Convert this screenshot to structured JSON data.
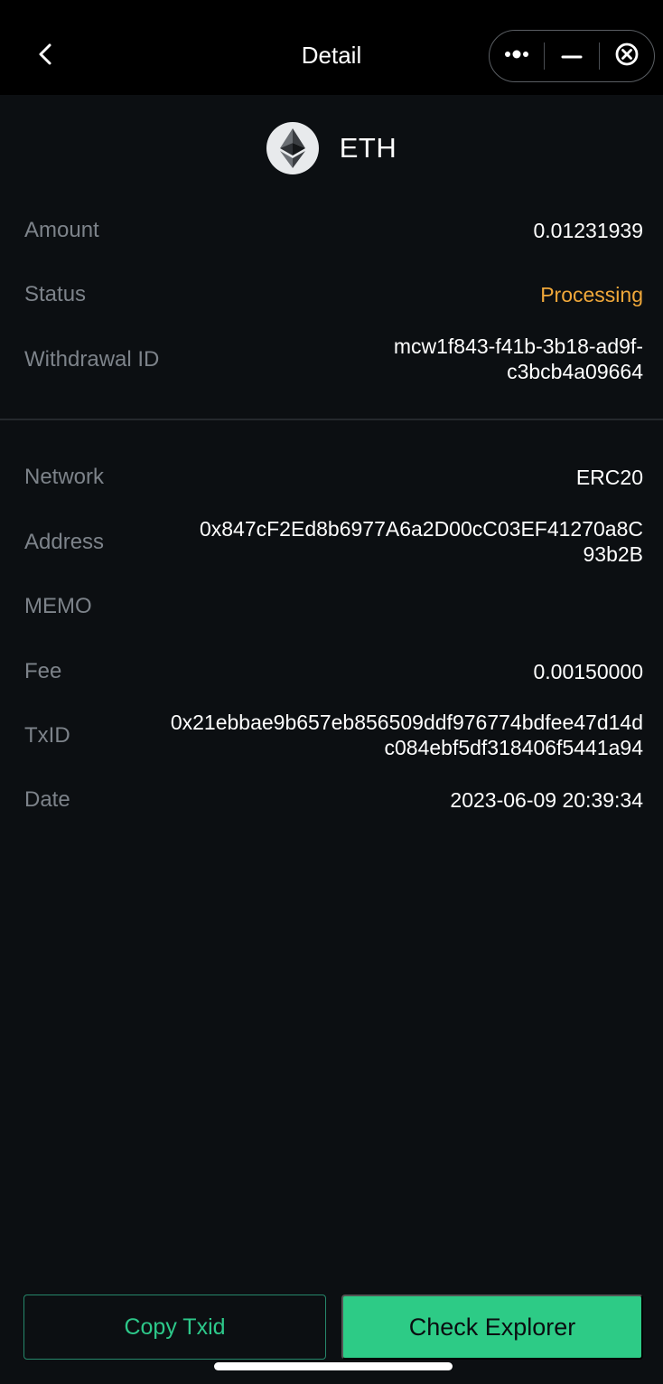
{
  "header": {
    "title": "Detail",
    "back_icon": "chevron-left-icon",
    "more_icon": "more-dots-icon",
    "minimize_icon": "minimize-icon",
    "close_icon": "close-circle-icon"
  },
  "coin": {
    "name": "ETH",
    "icon": "ethereum-logo-icon"
  },
  "summary": {
    "amount_label": "Amount",
    "amount_value": "0.01231939",
    "status_label": "Status",
    "status_value": "Processing",
    "status_color": "#f0a83a",
    "withdrawal_id_label": "Withdrawal ID",
    "withdrawal_id_line1": "mcw1f843-f41b-3b18-ad9f-",
    "withdrawal_id_line2": "c3bcb4a09664"
  },
  "details": {
    "network_label": "Network",
    "network_value": "ERC20",
    "address_label": "Address",
    "address_line1": "0x847cF2Ed8b6977A6a2D00cC03EF41270a8C",
    "address_line2": "93b2B",
    "memo_label": "MEMO",
    "memo_value": "",
    "fee_label": "Fee",
    "fee_value": "0.00150000",
    "txid_label": "TxID",
    "txid_line1": "0x21ebbae9b657eb856509ddf976774bdfee47d14d",
    "txid_line2": "c084ebf5df318406f5441a94",
    "date_label": "Date",
    "date_value": "2023-06-09 20:39:34"
  },
  "actions": {
    "copy_txid_label": "Copy Txid",
    "check_explorer_label": "Check Explorer",
    "accent_color": "#2dcb86"
  }
}
